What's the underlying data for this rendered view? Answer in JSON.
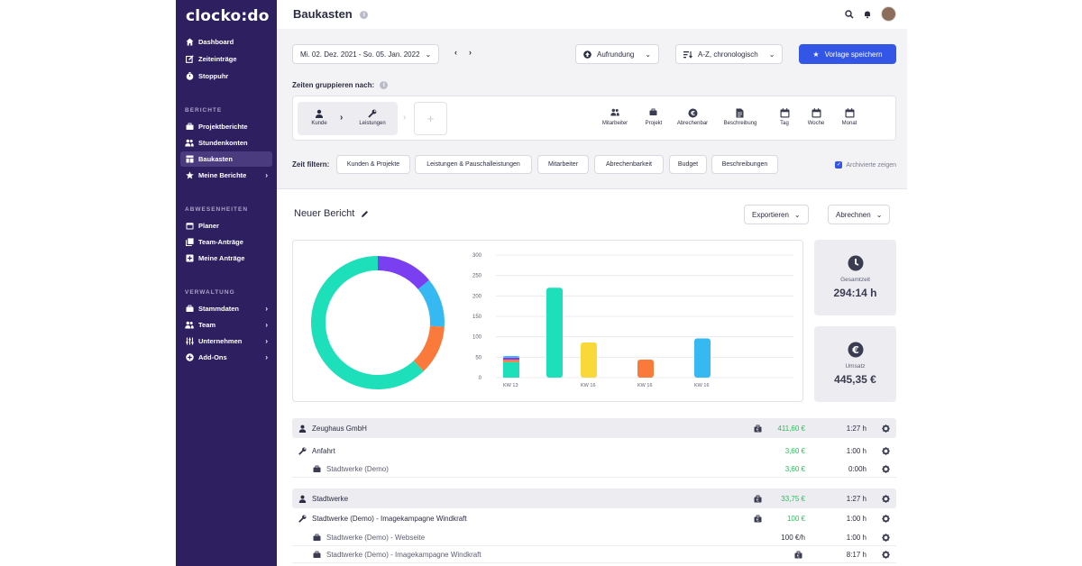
{
  "app": {
    "logo": "clocko:do"
  },
  "sidebar": {
    "main_items": [
      {
        "label": "Dashboard",
        "icon": "home-icon"
      },
      {
        "label": "Zeiteinträge",
        "icon": "edit-icon"
      },
      {
        "label": "Stoppuhr",
        "icon": "stopwatch-icon"
      }
    ],
    "sections": [
      {
        "title": "BERICHTE",
        "items": [
          {
            "label": "Projektberichte",
            "icon": "briefcase-icon",
            "chevron": false,
            "active": false
          },
          {
            "label": "Stundenkonten",
            "icon": "users-icon",
            "chevron": false,
            "active": false
          },
          {
            "label": "Baukasten",
            "icon": "layout-icon",
            "chevron": false,
            "active": true
          },
          {
            "label": "Meine Berichte",
            "icon": "star-icon",
            "chevron": true,
            "active": false
          }
        ]
      },
      {
        "title": "ABWESENHEITEN",
        "items": [
          {
            "label": "Planer",
            "icon": "calendar-icon",
            "chevron": false,
            "active": false
          },
          {
            "label": "Team-Anträge",
            "icon": "copy-icon",
            "chevron": false,
            "active": false
          },
          {
            "label": "Meine Anträge",
            "icon": "plus-square-icon",
            "chevron": false,
            "active": false
          }
        ]
      },
      {
        "title": "VERWALTUNG",
        "items": [
          {
            "label": "Stammdaten",
            "icon": "briefcase-icon",
            "chevron": true,
            "active": false
          },
          {
            "label": "Team",
            "icon": "users-icon",
            "chevron": true,
            "active": false
          },
          {
            "label": "Unternehmen",
            "icon": "sliders-icon",
            "chevron": true,
            "active": false
          },
          {
            "label": "Add-Ons",
            "icon": "plus-circle-icon",
            "chevron": true,
            "active": false
          }
        ]
      }
    ]
  },
  "header": {
    "title": "Baukasten"
  },
  "toolbar": {
    "date_range": "Mi. 02. Dez. 2021 - So. 05. Jan. 2022",
    "rounding": "Aufrundung",
    "sorting": "A-Z, chronologisch",
    "save_template": "Vorlage speichern"
  },
  "grouping": {
    "label": "Zeiten gruppieren nach:",
    "selected": [
      "Kunde",
      "Leistungen"
    ],
    "options": [
      "Mitarbeiter",
      "Projekt",
      "Abrechenbar",
      "Beschreibung",
      "Tag",
      "Woche",
      "Monat"
    ]
  },
  "filters": {
    "label": "Zeit filtern:",
    "chips": [
      "Kunden & Projekte",
      "Leistungen & Pauschalleistungen",
      "Mitarbeiter",
      "Abrechenbarkeit",
      "Budget",
      "Beschreibungen"
    ],
    "archived": "Archivierte zeigen"
  },
  "report": {
    "title": "Neuer Bericht",
    "export": "Exportieren",
    "billing": "Abrechnen"
  },
  "stats": {
    "total_label": "Gesamtzeit",
    "total_value": "294:14 h",
    "revenue_label": "Umsatz",
    "revenue_value": "445,35 €"
  },
  "chart_data": [
    {
      "type": "pie",
      "donut": true,
      "slices": [
        {
          "value": 14,
          "color": "#7b3ff2"
        },
        {
          "value": 12,
          "color": "#36b9f2"
        },
        {
          "value": 12,
          "color": "#f97a3a"
        },
        {
          "value": 62,
          "color": "#1de0bb"
        }
      ]
    },
    {
      "type": "bar",
      "ylim": [
        0,
        300
      ],
      "y_ticks": [
        0,
        50,
        100,
        150,
        200,
        250,
        300
      ],
      "grid": true,
      "bars": [
        {
          "label": "KW 13",
          "stack": [
            {
              "value": 38,
              "color": "#1de0bb"
            },
            {
              "value": 6,
              "color": "#f97a3a"
            },
            {
              "value": 5,
              "color": "#7b3ff2"
            },
            {
              "value": 4,
              "color": "#36b9f2"
            }
          ]
        },
        {
          "label": "",
          "stack": [
            {
              "value": 220,
              "color": "#1de0bb"
            }
          ]
        },
        {
          "label": "KW 16",
          "stack": [
            {
              "value": 86,
              "color": "#f9d93a"
            }
          ]
        },
        {
          "label": "KW 16",
          "stack": [
            {
              "value": 44,
              "color": "#f97a3a"
            }
          ]
        },
        {
          "label": "KW 16",
          "stack": [
            {
              "value": 96,
              "color": "#36b9f2"
            }
          ]
        }
      ]
    }
  ],
  "rows": [
    {
      "kind": "grp",
      "icon": "user-icon",
      "label": "Zeughaus GmbH",
      "bag": true,
      "amount": "411,60 €",
      "amount_green": true,
      "time": "1:27 h"
    },
    {
      "kind": "lvl1",
      "icon": "wrench-icon",
      "label": "Anfahrt",
      "bag": false,
      "amount": "3,60 €",
      "amount_green": true,
      "time": "1:00 h"
    },
    {
      "kind": "lvl2",
      "icon": "briefcase-icon",
      "label": "Stadtwerke (Demo)",
      "bag": false,
      "amount": "3,60 €",
      "amount_green": true,
      "time": "0:00h"
    },
    {
      "kind": "grp",
      "icon": "user-icon",
      "label": "Stadtwerke",
      "bag": true,
      "amount": "33,75 €",
      "amount_green": true,
      "time": "1:27 h"
    },
    {
      "kind": "lvl1",
      "icon": "wrench-icon",
      "label": "Stadtwerke (Demo) - Imagekampagne Windkraft",
      "bag": true,
      "amount": "100 €",
      "amount_green": true,
      "time": "1:00 h"
    },
    {
      "kind": "lvl2",
      "icon": "briefcase-icon",
      "label": "Stadtwerke (Demo) - Webseite",
      "bag": false,
      "amount": "100 €/h",
      "amount_green": false,
      "time": "1:00 h"
    },
    {
      "kind": "lvl2",
      "icon": "briefcase-icon",
      "label": "Stadtwerke (Demo) - Imagekampagne Windkraft",
      "bag": true,
      "amount": "",
      "amount_green": false,
      "time": "8:17 h"
    }
  ],
  "colors": {
    "sidebar": "#2e2060",
    "primary": "#3456e6",
    "green": "#2bbf5c"
  }
}
